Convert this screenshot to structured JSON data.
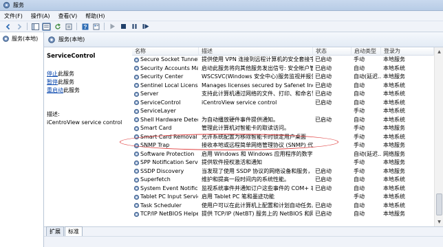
{
  "window": {
    "title": "服务"
  },
  "menu": [
    "文件(F)",
    "操作(A)",
    "查看(V)",
    "帮助(H)"
  ],
  "toolbar_icons": [
    "back-icon",
    "forward-icon",
    "console-tree-icon",
    "show-hide-icon",
    "refresh-icon",
    "export-icon",
    "help-icon",
    "properties-icon",
    "start-service-icon",
    "stop-service-icon",
    "pause-service-icon",
    "restart-service-icon"
  ],
  "tree": {
    "root_label": "服务(本地)"
  },
  "main": {
    "header_title": "服务(本地)",
    "selected_service": "ServiceControl",
    "actions": [
      {
        "link": "停止",
        "suffix": "此服务"
      },
      {
        "link": "暂停",
        "suffix": "此服务"
      },
      {
        "link": "重启动",
        "suffix": "此服务"
      }
    ],
    "description_label": "描述:",
    "description_text": "iCentroView service control"
  },
  "columns": [
    "名称",
    "描述",
    "状态",
    "启动类型",
    "登录为"
  ],
  "rows": [
    {
      "name": "Secure Socket Tunneli...",
      "desc": "提供使用 VPN 连接到远程计算机的安全套接字...",
      "status": "已启动",
      "startup": "手动",
      "logon": "本地服务"
    },
    {
      "name": "Security Accounts Man...",
      "desc": "启动此服务将向其他服务发出信号: 安全帐户管...",
      "status": "已启动",
      "startup": "自动",
      "logon": "本地系统"
    },
    {
      "name": "Security Center",
      "desc": "WSCSVC(Windows 安全中心)服务监视并报告计...",
      "status": "已启动",
      "startup": "自动(延迟...",
      "logon": "本地服务"
    },
    {
      "name": "Sentinel Local License ...",
      "desc": "Manages licenses secured by Safenet Inc. S...",
      "status": "已启动",
      "startup": "自动",
      "logon": "本地系统"
    },
    {
      "name": "Server",
      "desc": "支持此计算机通过网络的文件、打印、和命名管...",
      "status": "已启动",
      "startup": "自动",
      "logon": "本地系统"
    },
    {
      "name": "ServiceControl",
      "desc": "iCentroView service control",
      "status": "已启动",
      "startup": "自动",
      "logon": "本地系统"
    },
    {
      "name": "ServiceLayer",
      "desc": "",
      "status": "",
      "startup": "手动",
      "logon": "本地系统"
    },
    {
      "name": "Shell Hardware Detect...",
      "desc": "为自动播放硬件事件提供通知。",
      "status": "已启动",
      "startup": "自动",
      "logon": "本地系统"
    },
    {
      "name": "Smart Card",
      "desc": "管理此计算机对智能卡的取读访问。",
      "status": "",
      "startup": "手动",
      "logon": "本地服务"
    },
    {
      "name": "Smart Card Removal P...",
      "desc": "允许系统配置为移除智能卡时锁定用户桌面",
      "status": "",
      "startup": "手动",
      "logon": "本地系统"
    },
    {
      "name": "SNMP Trap",
      "desc": "接收本地或远程简单网络管理协议 (SNMP) 代...",
      "status": "",
      "startup": "手动",
      "logon": "本地服务"
    },
    {
      "name": "Software Protection",
      "desc": "启用 Windows 和 Windows 应用程序的数字许...",
      "status": "",
      "startup": "自动(延迟...",
      "logon": "网络服务"
    },
    {
      "name": "SPP Notification Service",
      "desc": "提供软件授权激活和通知",
      "status": "",
      "startup": "手动",
      "logon": "本地服务"
    },
    {
      "name": "SSDP Discovery",
      "desc": "当发现了使用 SSDP 协议的网络设备和服务，...",
      "status": "已启动",
      "startup": "手动",
      "logon": "本地服务"
    },
    {
      "name": "Superfetch",
      "desc": "维护和提高一段时间内的系统性能。",
      "status": "已启动",
      "startup": "自动",
      "logon": "本地系统"
    },
    {
      "name": "System Event Notificat...",
      "desc": "监视系统事件并通知订户这些事件的 COM+ 事...",
      "status": "已启动",
      "startup": "自动",
      "logon": "本地系统"
    },
    {
      "name": "Tablet PC Input Service",
      "desc": "启用 Tablet PC 笔和墨迹功能",
      "status": "",
      "startup": "手动",
      "logon": "本地系统"
    },
    {
      "name": "Task Scheduler",
      "desc": "使用户可以在此计算机上配置和计划自动任务。...",
      "status": "已启动",
      "startup": "自动",
      "logon": "本地系统"
    },
    {
      "name": "TCP/IP NetBIOS Helper",
      "desc": "提供 TCP/IP (NetBT) 服务上的 NetBIOS 和网...",
      "status": "已启动",
      "startup": "自动",
      "logon": "本地服务"
    }
  ],
  "tabs": [
    "扩展",
    "标准"
  ],
  "colors": {
    "link": "#0645ad",
    "highlight_ring": "#e04040",
    "gear": "#4a78b5"
  }
}
